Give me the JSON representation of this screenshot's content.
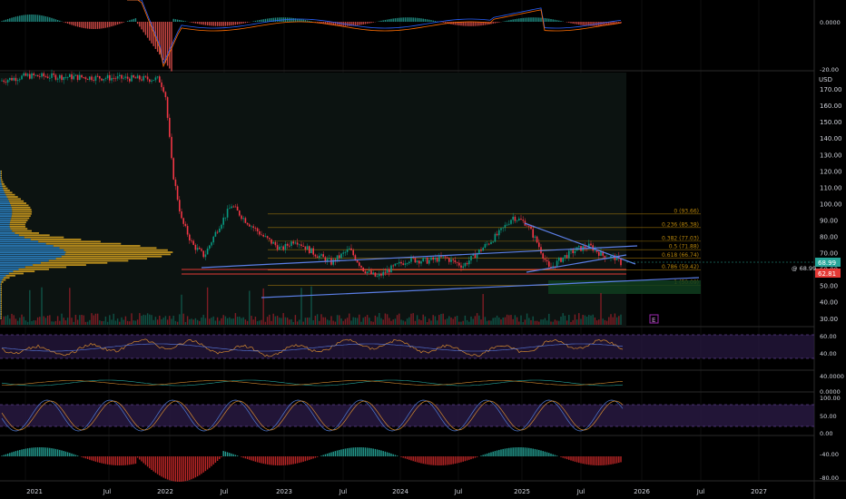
{
  "colors": {
    "background": "#000000",
    "up": "#089981",
    "down": "#f23645",
    "volume_profile_up": "#2f8bd1",
    "volume_profile_down": "#d9a520",
    "trend_line": "#5b7ee5",
    "fib_line": "#b8860b",
    "rsi_line": "#d48a2f",
    "stoch_k": "#4f7bd6",
    "stoch_d": "#d48a2f",
    "band": "#2a1a45",
    "current_price": "#26a69a",
    "last_close": "#e53935",
    "grid": "#1c1c1c"
  },
  "price_scale": {
    "currency": "USD",
    "ticks": [
      "170.00",
      "160.00",
      "150.00",
      "140.00",
      "130.00",
      "120.00",
      "110.00",
      "100.00",
      "90.00",
      "80.00",
      "70.00",
      "60.00",
      "50.00",
      "40.00",
      "30.00"
    ],
    "current_price_label": "68.99",
    "last_close_label": "62.81",
    "crosshair_label": "@ 68.99"
  },
  "macd_pane": {
    "ticks": [
      "0.0000",
      "-20.00"
    ]
  },
  "rsi_pane": {
    "ticks": [
      "60.00",
      "40.00"
    ]
  },
  "osc_pane": {
    "ticks": [
      "40.0000",
      "0.0000"
    ]
  },
  "stoch_pane": {
    "ticks": [
      "100.00",
      "50.00",
      "0.00"
    ]
  },
  "histo_pane": {
    "ticks": [
      "-40.00",
      "-80.00"
    ]
  },
  "fib_levels": [
    {
      "label": "0 (93.66)",
      "price": 93.66
    },
    {
      "label": "0.236 (85.38)",
      "price": 85.38
    },
    {
      "label": "0.382 (77.03)",
      "price": 77.03
    },
    {
      "label": "0.5 (71.88)",
      "price": 71.88
    },
    {
      "label": "0.618 (66.74)",
      "price": 66.74
    },
    {
      "label": "0.786 (59.42)",
      "price": 59.42
    },
    {
      "label": "1 (50.09)",
      "price": 50.09
    }
  ],
  "time_axis": {
    "labels": [
      "2021",
      "Jul",
      "2022",
      "Jul",
      "2023",
      "Jul",
      "2024",
      "Jul",
      "2025",
      "Jul",
      "2026",
      "Jul",
      "2027"
    ]
  },
  "event_marker": "E",
  "chart_data": {
    "type": "candlestick",
    "price_range": [
      25,
      180
    ],
    "price_series_approx": [
      {
        "t": "2022-01",
        "close": 170
      },
      {
        "t": "2022-02",
        "close": 115
      },
      {
        "t": "2022-03",
        "close": 80
      },
      {
        "t": "2022-05",
        "close": 68
      },
      {
        "t": "2022-06",
        "close": 100
      },
      {
        "t": "2022-08",
        "close": 85
      },
      {
        "t": "2022-10",
        "close": 72
      },
      {
        "t": "2023-01",
        "close": 70
      },
      {
        "t": "2023-04",
        "close": 66
      },
      {
        "t": "2023-07",
        "close": 72
      },
      {
        "t": "2023-10",
        "close": 55
      },
      {
        "t": "2024-01",
        "close": 62
      },
      {
        "t": "2024-04",
        "close": 67
      },
      {
        "t": "2024-07",
        "close": 63
      },
      {
        "t": "2024-10",
        "close": 83
      },
      {
        "t": "2024-12",
        "close": 92
      },
      {
        "t": "2025-02",
        "close": 84
      },
      {
        "t": "2025-04",
        "close": 60
      },
      {
        "t": "2025-06",
        "close": 72
      },
      {
        "t": "2025-08",
        "close": 68
      },
      {
        "t": "2025-10",
        "close": 62.81
      }
    ]
  }
}
